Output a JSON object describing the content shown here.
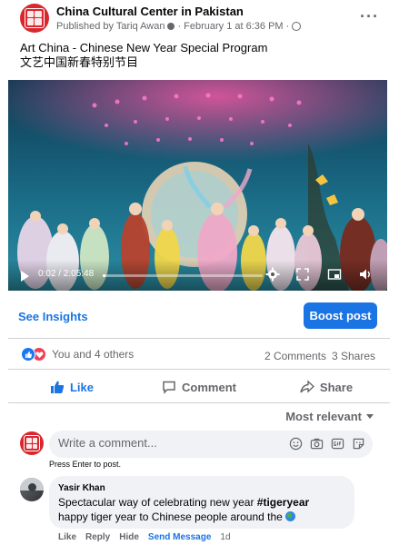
{
  "post": {
    "page_name": "China Cultural Center in Pakistan",
    "published_by": "Published by Tariq Awan",
    "date": "February 1 at 6:36 PM",
    "separator": "·",
    "caption_line1": "Art China - Chinese New Year Special Program",
    "caption_line2": "文艺中国新春特别节目"
  },
  "video": {
    "timecode": "0:02 / 2:05:48",
    "progress_fraction": 0.016
  },
  "insights": {
    "see_insights": "See Insights",
    "boost_post": "Boost post"
  },
  "engagement": {
    "reaction_summary": "You and 4 others",
    "comments": "2 Comments",
    "shares": "3 Shares"
  },
  "actions": {
    "like": "Like",
    "comment": "Comment",
    "share": "Share"
  },
  "comments_section": {
    "sort": "Most relevant",
    "input_placeholder": "Write a comment...",
    "hint": "Press Enter to post.",
    "items": [
      {
        "author": "Yasir Khan",
        "text_before": "Spectacular way of celebrating new year ",
        "hashtag": "#tigeryear",
        "text_after": "happy tiger year to Chinese people around the",
        "actions": {
          "like": "Like",
          "reply": "Reply",
          "hide": "Hide",
          "send": "Send Message",
          "age": "1d"
        }
      }
    ]
  },
  "icons": {
    "more": "more-horizontal-icon",
    "emoji": "emoji-icon",
    "camera": "camera-icon",
    "gif": "gif-icon",
    "sticker": "sticker-icon"
  },
  "colors": {
    "accent": "#1b74e4",
    "brand_red": "#d9272e",
    "muted": "#65676b"
  }
}
